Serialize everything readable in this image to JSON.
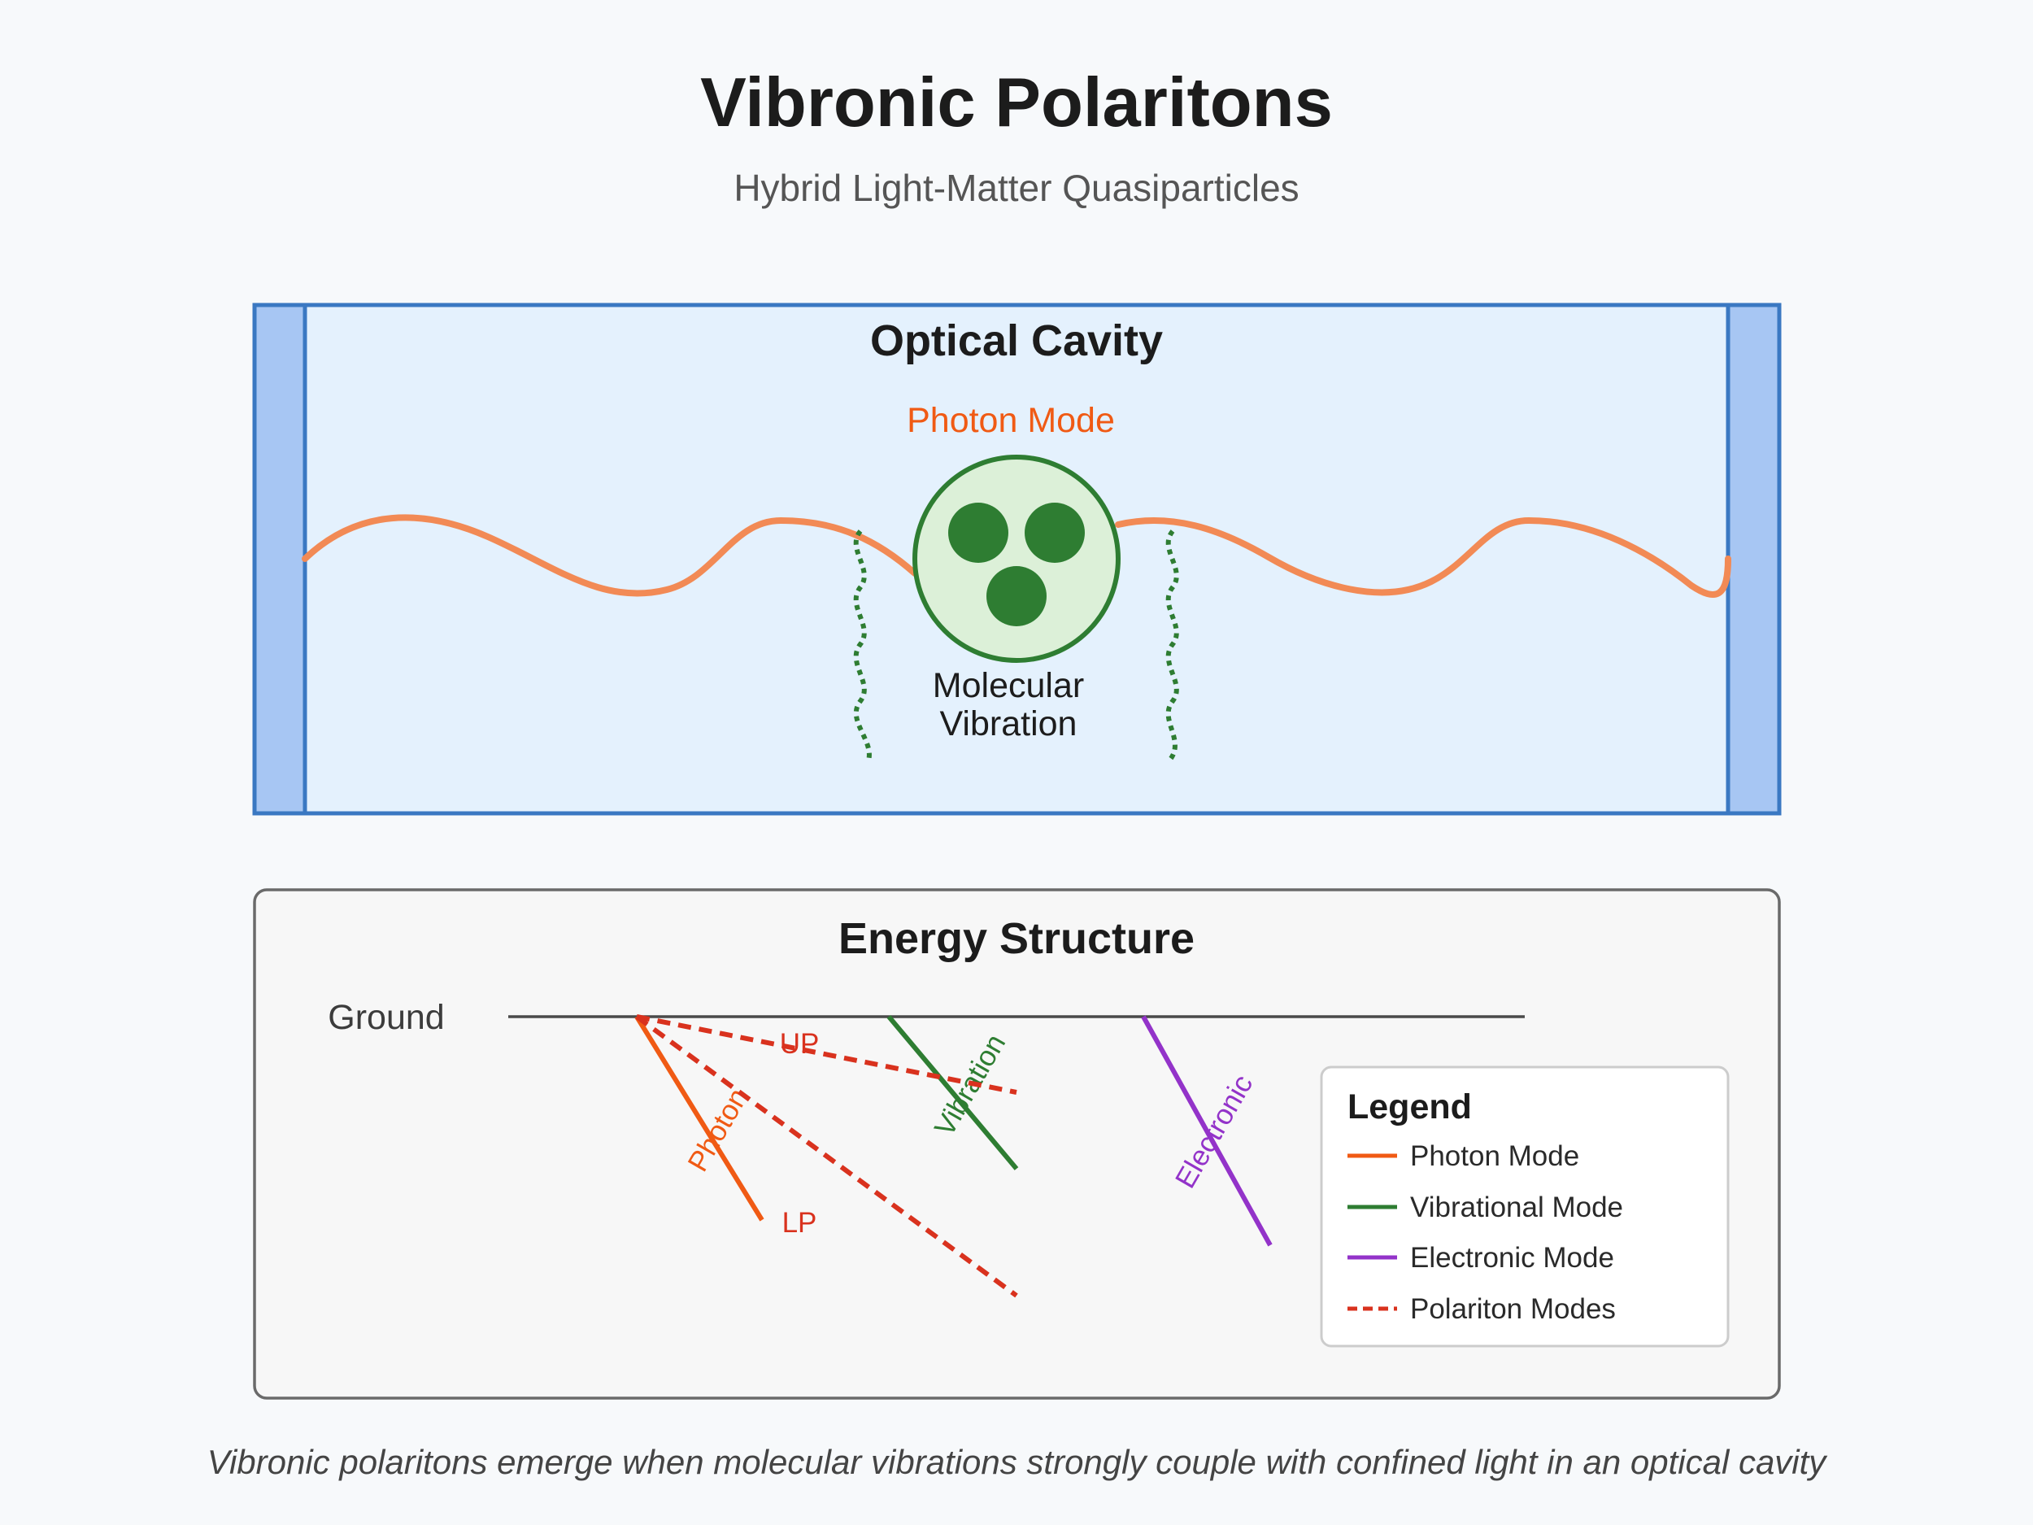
{
  "header": {
    "title": "Vibronic Polaritons",
    "subtitle": "Hybrid Light-Matter Quasiparticles"
  },
  "cavity": {
    "title": "Optical Cavity",
    "photon_label": "Photon Mode",
    "molecule_label_line1": "Molecular",
    "molecule_label_line2": "Vibration"
  },
  "energy": {
    "title": "Energy Structure",
    "ground_label": "Ground",
    "photon_line_label": "Photon",
    "vibration_line_label": "Vibration",
    "electronic_line_label": "Electronic",
    "up_label": "UP",
    "lp_label": "LP"
  },
  "legend": {
    "title": "Legend",
    "items": [
      {
        "label": "Photon Mode",
        "color": "#f05a14",
        "style": "solid"
      },
      {
        "label": "Vibrational Mode",
        "color": "#2e7d32",
        "style": "solid"
      },
      {
        "label": "Electronic Mode",
        "color": "#9333c9",
        "style": "solid"
      },
      {
        "label": "Polariton Modes",
        "color": "#d9321e",
        "style": "dashed"
      }
    ]
  },
  "caption": "Vibronic polaritons emerge when molecular vibrations strongly couple with confined light in an optical cavity",
  "colors": {
    "cavity_fill": "#e4f1fd",
    "cavity_border": "#3a78c2",
    "mirror_fill": "#a7c6f3",
    "photon_wave": "#f28a55",
    "molecule_fill": "#dcf0d8",
    "molecule_dark": "#2e7d32"
  }
}
